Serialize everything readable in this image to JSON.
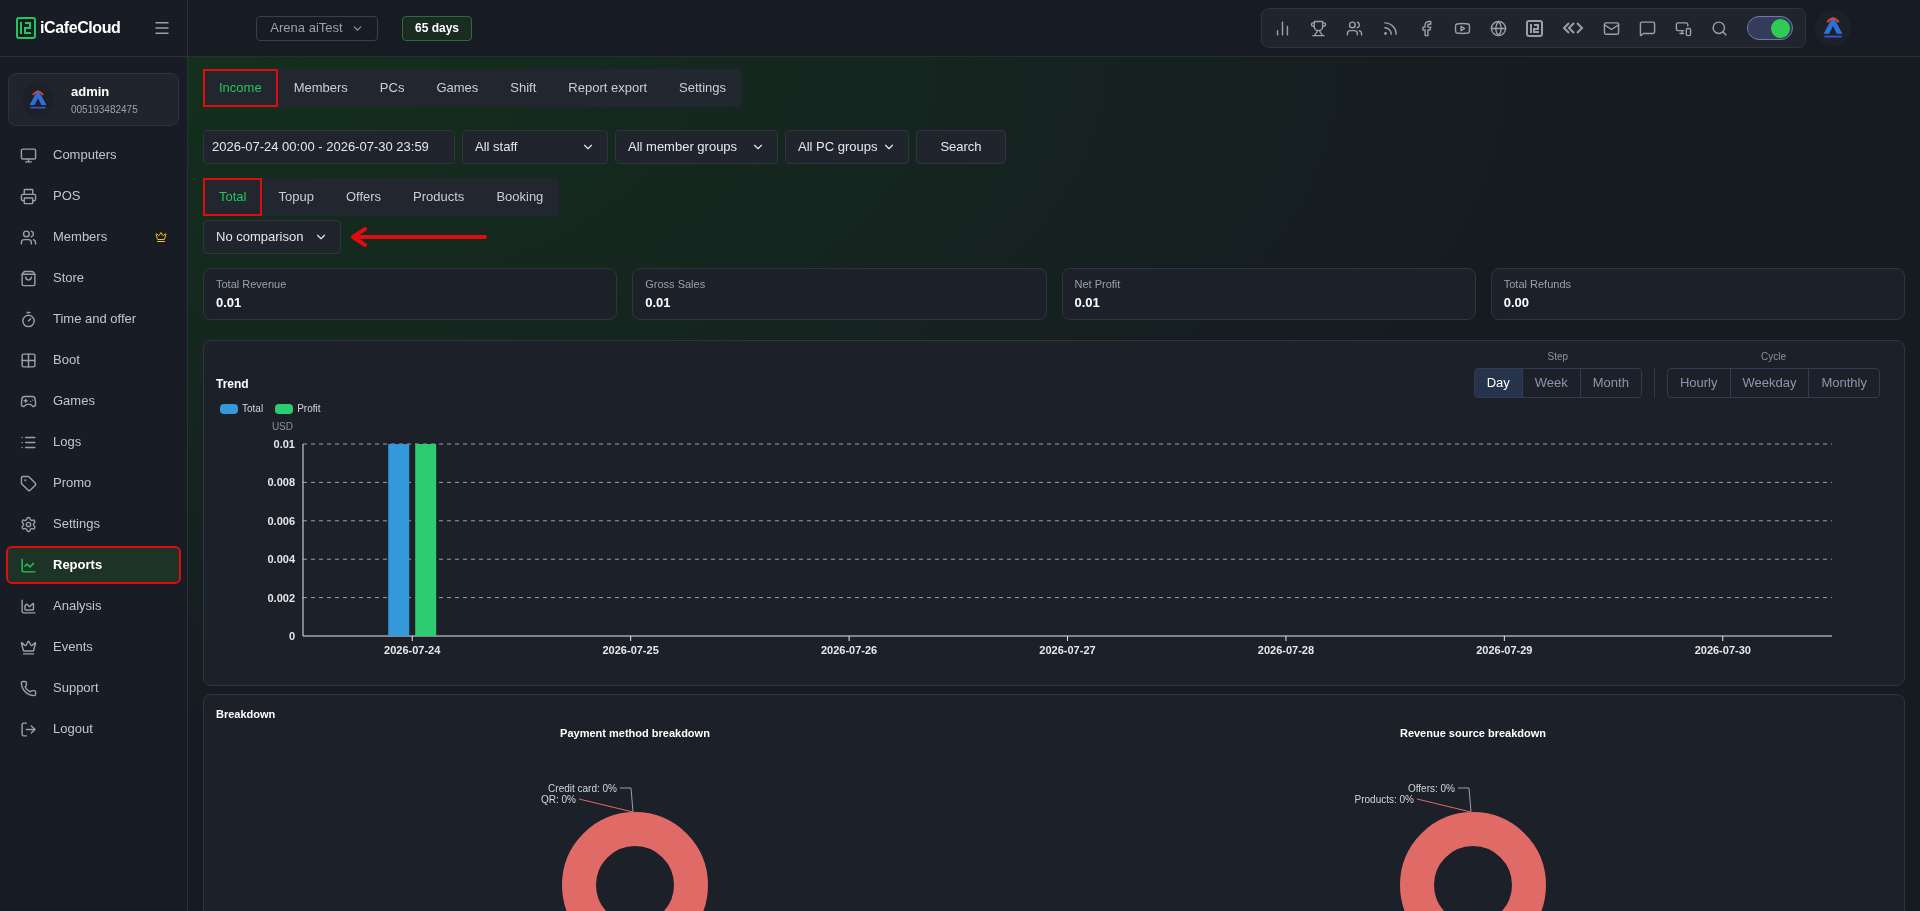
{
  "brand": {
    "name": "iCafeCloud"
  },
  "topbar": {
    "site": "Arena aiTest",
    "license": "65 days",
    "theme_toggle": {
      "on": true
    }
  },
  "user": {
    "name": "admin",
    "id": "005193482475"
  },
  "sidebar": {
    "items": [
      {
        "label": "Computers",
        "selected": false,
        "annotated": false
      },
      {
        "label": "POS",
        "selected": false,
        "annotated": false
      },
      {
        "label": "Members",
        "selected": false,
        "annotated": false
      },
      {
        "label": "Store",
        "selected": false,
        "annotated": false
      },
      {
        "label": "Time and offer",
        "selected": false,
        "annotated": false
      },
      {
        "label": "Boot",
        "selected": false,
        "annotated": false
      },
      {
        "label": "Games",
        "selected": false,
        "annotated": false
      },
      {
        "label": "Logs",
        "selected": false,
        "annotated": false
      },
      {
        "label": "Promo",
        "selected": false,
        "annotated": false
      },
      {
        "label": "Settings",
        "selected": false,
        "annotated": false
      },
      {
        "label": "Reports",
        "selected": true,
        "annotated": true
      },
      {
        "label": "Analysis",
        "selected": false,
        "annotated": false
      },
      {
        "label": "Events",
        "selected": false,
        "annotated": false
      },
      {
        "label": "Support",
        "selected": false,
        "annotated": false
      },
      {
        "label": "Logout",
        "selected": false,
        "annotated": false
      }
    ]
  },
  "report_tabs": [
    {
      "label": "Income",
      "selected": true,
      "annotated": true
    },
    {
      "label": "Members",
      "selected": false,
      "annotated": false
    },
    {
      "label": "PCs",
      "selected": false,
      "annotated": false
    },
    {
      "label": "Games",
      "selected": false,
      "annotated": false
    },
    {
      "label": "Shift",
      "selected": false,
      "annotated": false
    },
    {
      "label": "Report export",
      "selected": false,
      "annotated": false
    },
    {
      "label": "Settings",
      "selected": false,
      "annotated": false
    }
  ],
  "filters": {
    "date_range": "2026-07-24 00:00 - 2026-07-30 23:59",
    "staff": "All staff",
    "member_groups": "All member groups",
    "pc_groups": "All PC groups",
    "search_button": "Search"
  },
  "income_tabs": [
    {
      "label": "Total",
      "selected": true,
      "annotated": true
    },
    {
      "label": "Topup",
      "selected": false,
      "annotated": false
    },
    {
      "label": "Offers",
      "selected": false,
      "annotated": false
    },
    {
      "label": "Products",
      "selected": false,
      "annotated": false
    },
    {
      "label": "Booking",
      "selected": false,
      "annotated": false
    }
  ],
  "comparison": {
    "value": "No comparison",
    "annotation_arrow": true
  },
  "stats": [
    {
      "label": "Total Revenue",
      "value": "0.01"
    },
    {
      "label": "Gross Sales",
      "value": "0.01"
    },
    {
      "label": "Net Profit",
      "value": "0.01"
    },
    {
      "label": "Total Refunds",
      "value": "0.00"
    }
  ],
  "trend": {
    "title": "Trend",
    "step": {
      "label": "Step",
      "options": [
        {
          "label": "Day",
          "selected": true
        },
        {
          "label": "Week",
          "selected": false
        },
        {
          "label": "Month",
          "selected": false
        }
      ]
    },
    "cycle": {
      "label": "Cycle",
      "options": [
        {
          "label": "Hourly",
          "selected": false
        },
        {
          "label": "Weekday",
          "selected": false
        },
        {
          "label": "Monthly",
          "selected": false
        }
      ]
    },
    "chart_data": {
      "type": "bar",
      "ylabel": "USD",
      "categories": [
        "2026-07-24",
        "2026-07-25",
        "2026-07-26",
        "2026-07-27",
        "2026-07-28",
        "2026-07-29",
        "2026-07-30"
      ],
      "series": [
        {
          "name": "Total",
          "color": "#3498db",
          "values": [
            0.01,
            0,
            0,
            0,
            0,
            0,
            0
          ]
        },
        {
          "name": "Profit",
          "color": "#2ecc71",
          "values": [
            0.01,
            0,
            0,
            0,
            0,
            0,
            0
          ]
        }
      ],
      "ylim": [
        0,
        0.01
      ],
      "grid": true,
      "yticks": [
        0,
        0.002,
        0.004,
        0.006,
        0.008,
        0.01
      ]
    }
  },
  "breakdown": {
    "title": "Breakdown",
    "charts": [
      {
        "title": "Payment method breakdown",
        "labels": [
          "Credit card: 0%",
          "QR: 0%"
        ]
      },
      {
        "title": "Revenue source breakdown",
        "labels": [
          "Offers: 0%",
          "Products: 0%"
        ]
      }
    ]
  }
}
